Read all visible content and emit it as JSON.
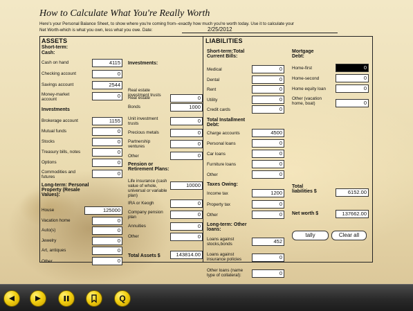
{
  "title": "How to Calculate What You're Really Worth",
  "intro_line1": "Here's your Personal Balance Sheet, to show where you're coming from--exactly how much you're worth today. Use it to calculate your",
  "intro_line2": "Net Worth-which is what you own, less what you owe. Date:",
  "date": "2/25/2012",
  "assets": {
    "heading": "ASSETS",
    "short_term_heading": "Short-term:",
    "cash_heading": "Cash:",
    "cash_on_hand": {
      "label": "Cash on hand",
      "value": "4115"
    },
    "checking": {
      "label": "Checking account",
      "value": "0"
    },
    "savings": {
      "label": "Savings account",
      "value": "2544"
    },
    "money_market": {
      "label": "Money-market account",
      "value": "0"
    },
    "investments_heading": "Investments",
    "brokerage": {
      "label": "Brokerage account",
      "value": "1155"
    },
    "mutual_funds": {
      "label": "Mutual funds",
      "value": "0"
    },
    "stocks": {
      "label": "Stocks",
      "value": "0"
    },
    "treasury": {
      "label": "Treasury bills, notes",
      "value": "0"
    },
    "options": {
      "label": "Options",
      "value": "0"
    },
    "commodities": {
      "label": "Commodities and futures",
      "value": "0"
    },
    "long_term_heading": "Long-term: Personal Property (Resale Values):",
    "house": {
      "label": "House",
      "value": "125000"
    },
    "vacation_home": {
      "label": "Vacation home",
      "value": "0"
    },
    "autos": {
      "label": "Auto(s)",
      "value": "0"
    },
    "jewelry": {
      "label": "Jewelry",
      "value": "0"
    },
    "art": {
      "label": "Art, antiques",
      "value": "0"
    },
    "other_personal": {
      "label": "Other",
      "value": "0"
    },
    "investments2_heading": "Investments:",
    "real_estate": {
      "label": "Real estate",
      "value": "0"
    },
    "reit": {
      "label": "Real estate investment trusts",
      "value": "0"
    },
    "bonds": {
      "label": "Bonds",
      "value": "1000"
    },
    "unit_trusts": {
      "label": "Unit investment trusts",
      "value": "0"
    },
    "precious_metals": {
      "label": "Precious metals",
      "value": "0"
    },
    "partnership": {
      "label": "Partnership ventures",
      "value": "0"
    },
    "other_invest": {
      "label": "Other",
      "value": "0"
    },
    "pension_heading": "Pension or Retirement Plans:",
    "life_insurance": {
      "label": "Life insurance (cash value of whole, universal or variable plan)",
      "value": "10000"
    },
    "ira": {
      "label": "IRA or Keogh",
      "value": "0"
    },
    "company_pension": {
      "label": "Company pension plan",
      "value": "0"
    },
    "annuities": {
      "label": "Annuities",
      "value": "0"
    },
    "other_pension": {
      "label": "Other",
      "value": "0"
    },
    "total": {
      "label": "Total Assets $",
      "value": "143814.00"
    }
  },
  "liabilities": {
    "heading": "LIABILITIES",
    "current_heading": "Short-term:Total Current Bills:",
    "medical": {
      "label": "Medical",
      "value": "0"
    },
    "dental": {
      "label": "Dental",
      "value": "0"
    },
    "rent": {
      "label": "Rent",
      "value": "0"
    },
    "utility": {
      "label": "Utility",
      "value": "0"
    },
    "credit_cards": {
      "label": "Credit cards",
      "value": "0"
    },
    "installment_heading": "Total Installment Debt:",
    "charge_accounts": {
      "label": "Charge accounts",
      "value": "4500"
    },
    "personal_loans": {
      "label": "Personal loans",
      "value": "0"
    },
    "car_loans": {
      "label": "Car loans",
      "value": "0"
    },
    "furniture_loans": {
      "label": "Furniture loans",
      "value": "0"
    },
    "other_install": {
      "label": "Other",
      "value": "0"
    },
    "taxes_heading": "Taxes Owing:",
    "income_tax": {
      "label": "Income tax",
      "value": "1200"
    },
    "property_tax": {
      "label": "Property tax",
      "value": "0"
    },
    "other_tax": {
      "label": "Other",
      "value": "0"
    },
    "long_term_heading": "Long-term: Other loans:",
    "loans_stocks": {
      "label": "Loans against stocks,bonds",
      "value": "452"
    },
    "loans_insurance": {
      "label": "Loans against insurance policies",
      "value": "0"
    },
    "other_loans": {
      "label": "Other loans (name type of collateral):",
      "value": "0"
    },
    "mortgage_heading": "Mortgage Debt:",
    "home_first": {
      "label": "Home-first",
      "value": "0"
    },
    "home_second": {
      "label": "Home-second",
      "value": "0"
    },
    "home_equity": {
      "label": "Home equity loan",
      "value": "0"
    },
    "other_mortgage": {
      "label": "Other (vacation home, boat)",
      "value": "0"
    },
    "total": {
      "label": "Total liabilities $",
      "value": "6152.00"
    },
    "net_worth": {
      "label": "Net worth $",
      "value": "137662.00"
    }
  },
  "buttons": {
    "tally": "tally",
    "clear": "Clear all"
  },
  "toolbar": {
    "items": [
      "back-icon",
      "forward-icon",
      "pause-icon",
      "bookmark-icon",
      "quit-icon"
    ],
    "quit_glyph": "Q",
    "accent": "#f2cf10"
  }
}
